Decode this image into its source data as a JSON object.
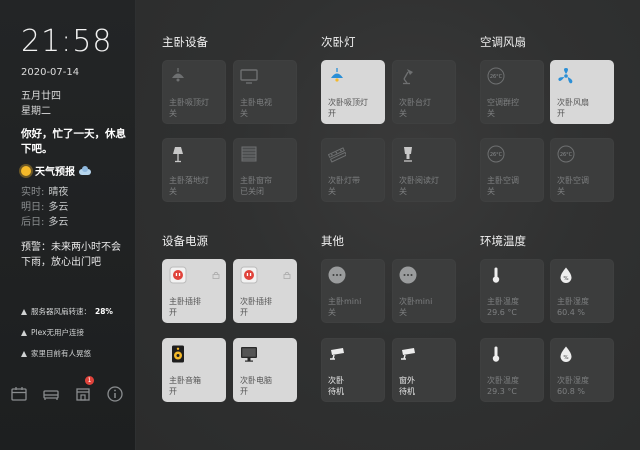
{
  "sidebar": {
    "time": "21:58",
    "date": "2020-07-14",
    "lunar": "五月廿四",
    "weekday": "星期二",
    "greeting": "你好，忙了一天，休息下吧。",
    "forecast_title": "天气预报",
    "forecast": [
      {
        "label": "实时:",
        "value": "晴夜"
      },
      {
        "label": "明日:",
        "value": "多云"
      },
      {
        "label": "后日:",
        "value": "多云"
      }
    ],
    "warning": "预警：未来两小时不会下雨，放心出门吧",
    "status": [
      {
        "text": "服务器风扇转速：",
        "value": "28%"
      },
      {
        "text": "Plex无用户连接",
        "value": ""
      },
      {
        "text": "家里目前有人晃悠",
        "value": ""
      }
    ],
    "bottom_icons": [
      "calendar-icon",
      "bed-icon",
      "home-icon",
      "info-icon"
    ],
    "notification_badge": "1"
  },
  "sections": {
    "master_bedroom": "主卧设备",
    "second_bedroom_light": "次卧灯",
    "ac_fan": "空调风扇",
    "power": "设备电源",
    "other": "其他",
    "environment": "环境温度"
  },
  "tiles": {
    "master_ceiling_light": {
      "name": "主卧吸顶灯",
      "state": "关"
    },
    "master_tv": {
      "name": "主卧电视",
      "state": "关"
    },
    "master_floor_lamp": {
      "name": "主卧落地灯",
      "state": "关"
    },
    "master_curtain": {
      "name": "主卧窗帘",
      "state": "已关闭"
    },
    "second_ceiling_light": {
      "name": "次卧吸顶灯",
      "state": "开"
    },
    "second_desk_lamp": {
      "name": "次卧台灯",
      "state": "关"
    },
    "second_light_strip": {
      "name": "次卧灯带",
      "state": "关"
    },
    "second_reading_lamp": {
      "name": "次卧阅读灯",
      "state": "关"
    },
    "ac_group": {
      "name": "空调群控",
      "state": "关",
      "icon_text": "26°C"
    },
    "second_fan": {
      "name": "次卧风扇",
      "state": "开"
    },
    "master_ac": {
      "name": "主卧空调",
      "state": "关",
      "icon_text": "26°C"
    },
    "second_ac": {
      "name": "次卧空调",
      "state": "关",
      "icon_text": "26°C"
    },
    "master_strip": {
      "name": "主卧插排",
      "state": "开"
    },
    "second_strip": {
      "name": "次卧插排",
      "state": "开"
    },
    "master_speaker": {
      "name": "主卧音箱",
      "state": "开"
    },
    "second_pc": {
      "name": "次卧电脑",
      "state": "开"
    },
    "master_mini": {
      "name": "主卧mini",
      "state": "关"
    },
    "second_mini": {
      "name": "次卧mini",
      "state": "关"
    },
    "second_camera": {
      "name": "次卧",
      "state": "待机"
    },
    "outdoor_camera": {
      "name": "窗外",
      "state": "待机"
    },
    "master_temp": {
      "name": "主卧温度",
      "state": "29.6 °C"
    },
    "master_humidity": {
      "name": "主卧湿度",
      "state": "60.4 %"
    },
    "second_temp": {
      "name": "次卧温度",
      "state": "29.3 °C"
    },
    "second_humidity": {
      "name": "次卧湿度",
      "state": "60.8 %"
    }
  },
  "colors": {
    "tile_on": "#d8d8d8",
    "tile_off": "#3c3d3d",
    "accent_blue": "#2b8fd6",
    "badge_red": "#e0433b"
  }
}
